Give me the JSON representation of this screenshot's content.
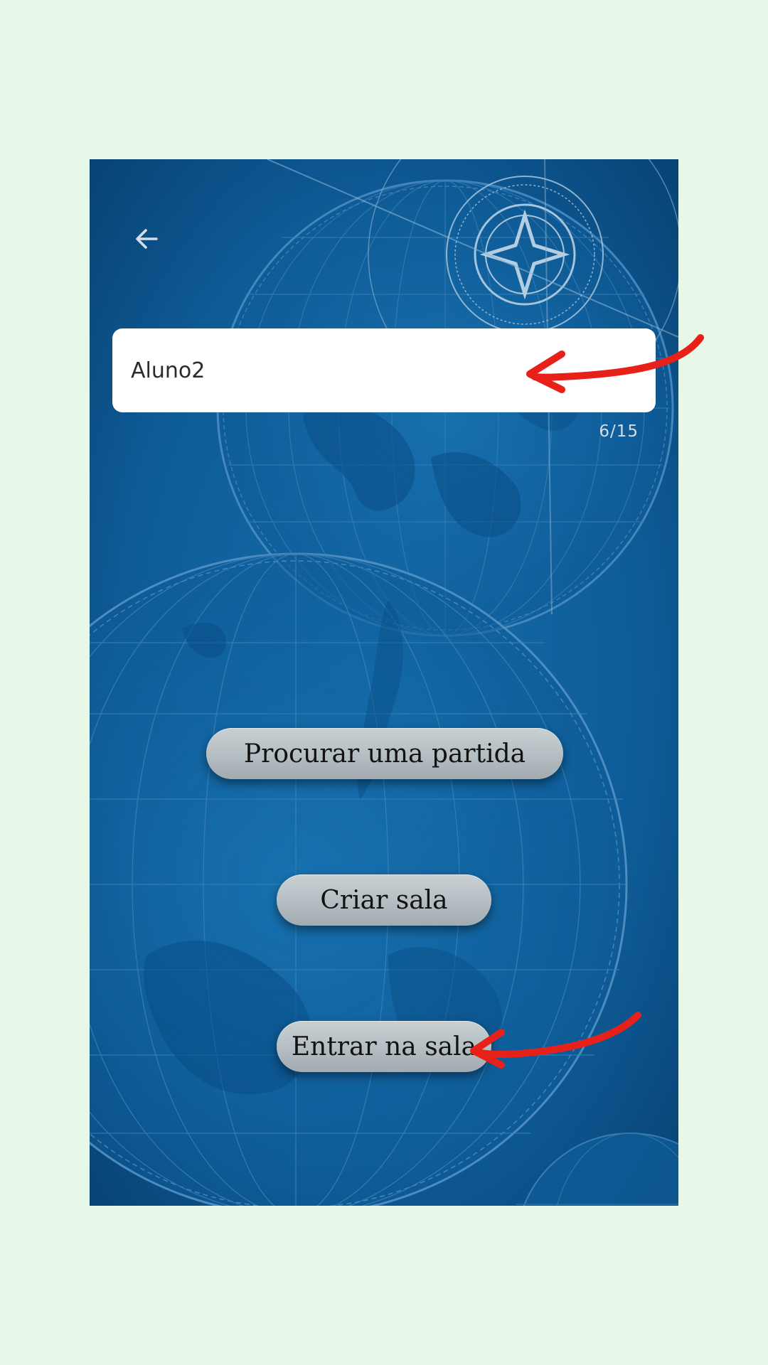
{
  "nav": {
    "back_icon": "arrow-left-icon"
  },
  "name_input": {
    "value": "Aluno2",
    "counter": "6/15"
  },
  "buttons": {
    "find_match": "Procurar uma partida",
    "create_room": "Criar sala",
    "join_room": "Entrar na sala"
  },
  "annotations": {
    "arrow_color": "#e8201a"
  },
  "colors": {
    "page_background": "#e7f8e8",
    "screen_background": "#0f5a94"
  }
}
